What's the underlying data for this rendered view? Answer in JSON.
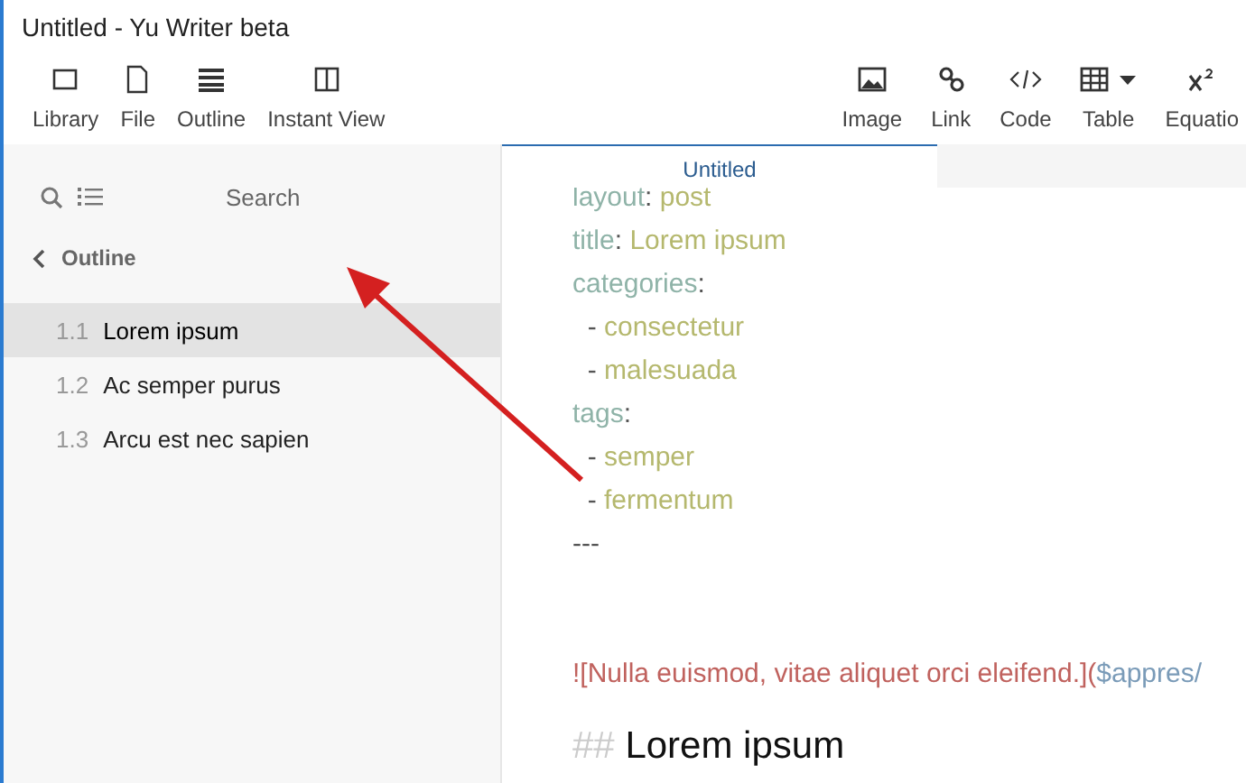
{
  "window": {
    "title": "Untitled - Yu Writer beta"
  },
  "toolbar_left": [
    {
      "label": "Library",
      "kind": "library"
    },
    {
      "label": "File",
      "kind": "file"
    },
    {
      "label": "Outline",
      "kind": "list"
    },
    {
      "label": "Instant View",
      "kind": "columns"
    }
  ],
  "toolbar_right": [
    {
      "label": "Image",
      "kind": "image"
    },
    {
      "label": "Link",
      "kind": "link"
    },
    {
      "label": "Code",
      "kind": "code"
    },
    {
      "label": "Table",
      "kind": "table",
      "dropdown": true
    },
    {
      "label": "Equatio",
      "kind": "superscript"
    }
  ],
  "sidebar": {
    "search": {
      "placeholder": "Search"
    },
    "outline_title": "Outline",
    "items": [
      {
        "number": "1.1",
        "label": "Lorem ipsum",
        "selected": true
      },
      {
        "number": "1.2",
        "label": "Ac semper purus",
        "selected": false
      },
      {
        "number": "1.3",
        "label": "Arcu est nec sapien",
        "selected": false
      }
    ]
  },
  "tabs": [
    {
      "label": "Untitled",
      "selected": true
    }
  ],
  "editor": {
    "lines": [
      {
        "kind": "text",
        "segments": [
          {
            "kind": "key",
            "text": "layout"
          },
          {
            "kind": "punct",
            "text": ": "
          },
          {
            "kind": "value",
            "text": "post"
          }
        ]
      },
      {
        "kind": "text",
        "segments": [
          {
            "kind": "key",
            "text": "title"
          },
          {
            "kind": "punct",
            "text": ": "
          },
          {
            "kind": "value",
            "text": "Lorem ipsum"
          }
        ]
      },
      {
        "kind": "text",
        "segments": [
          {
            "kind": "key",
            "text": "categories"
          },
          {
            "kind": "punct",
            "text": ":"
          }
        ]
      },
      {
        "kind": "text",
        "segments": [
          {
            "kind": "punct",
            "text": "  - "
          },
          {
            "kind": "value",
            "text": "consectetur"
          }
        ]
      },
      {
        "kind": "text",
        "segments": [
          {
            "kind": "punct",
            "text": "  - "
          },
          {
            "kind": "value",
            "text": "malesuada"
          }
        ]
      },
      {
        "kind": "text",
        "segments": [
          {
            "kind": "key",
            "text": "tags"
          },
          {
            "kind": "punct",
            "text": ":"
          }
        ]
      },
      {
        "kind": "text",
        "segments": [
          {
            "kind": "punct",
            "text": "  - "
          },
          {
            "kind": "value",
            "text": "semper"
          }
        ]
      },
      {
        "kind": "text",
        "segments": [
          {
            "kind": "punct",
            "text": "  - "
          },
          {
            "kind": "value",
            "text": "fermentum"
          }
        ]
      },
      {
        "kind": "text",
        "segments": [
          {
            "kind": "punct",
            "text": "---"
          }
        ]
      },
      {
        "kind": "blank"
      },
      {
        "kind": "text",
        "segments": [
          {
            "kind": "link_text",
            "text": "![Nulla euismod, vitae aliquet orci eleifend.]("
          },
          {
            "kind": "link_url",
            "text": "$appres/"
          }
        ]
      },
      {
        "kind": "heading",
        "segments": [
          {
            "kind": "heading_mark",
            "text": "## "
          },
          {
            "kind": "heading_text",
            "text": "Lorem ipsum"
          }
        ]
      }
    ]
  }
}
